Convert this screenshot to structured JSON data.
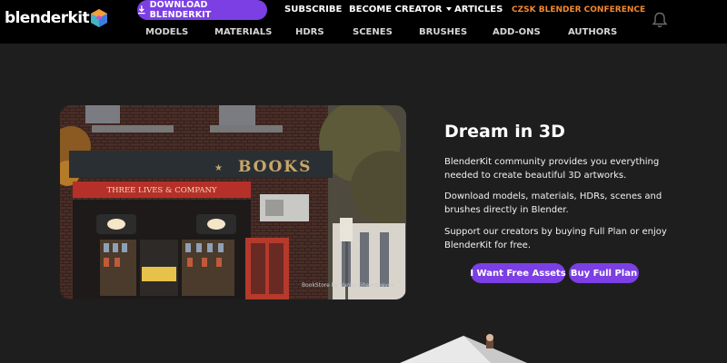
{
  "header": {
    "logo_text": "blenderkit",
    "download_label": "DOWNLOAD BLENDERKIT",
    "nav_top": [
      "SUBSCRIBE",
      "BECOME CREATOR",
      "ARTICLES"
    ],
    "conference_label": "CZSK BLENDER CONFERENCE",
    "nav_bottom": [
      "MODELS",
      "MATERIALS",
      "HDRS",
      "SCENES",
      "BRUSHES",
      "ADD-ONS",
      "AUTHORS"
    ],
    "accent_color": "#7b3fe4",
    "conference_color": "#f3892e"
  },
  "hero": {
    "image_caption": "BookStore by Vanko Gheorghevev",
    "storefront_sign": "BOOKS",
    "awning_text": "THREE LIVES & COMPANY",
    "title": "Dream in 3D",
    "paragraphs": [
      "BlenderKit community provides you everything needed to create beautiful 3D artworks.",
      "Download models, materials, HDRs, scenes and brushes directly in Blender.",
      "Support our creators by buying Full Plan or enjoy BlenderKit for free."
    ],
    "buttons": {
      "free_assets": "I Want Free Assets",
      "full_plan": "Buy Full Plan"
    }
  }
}
